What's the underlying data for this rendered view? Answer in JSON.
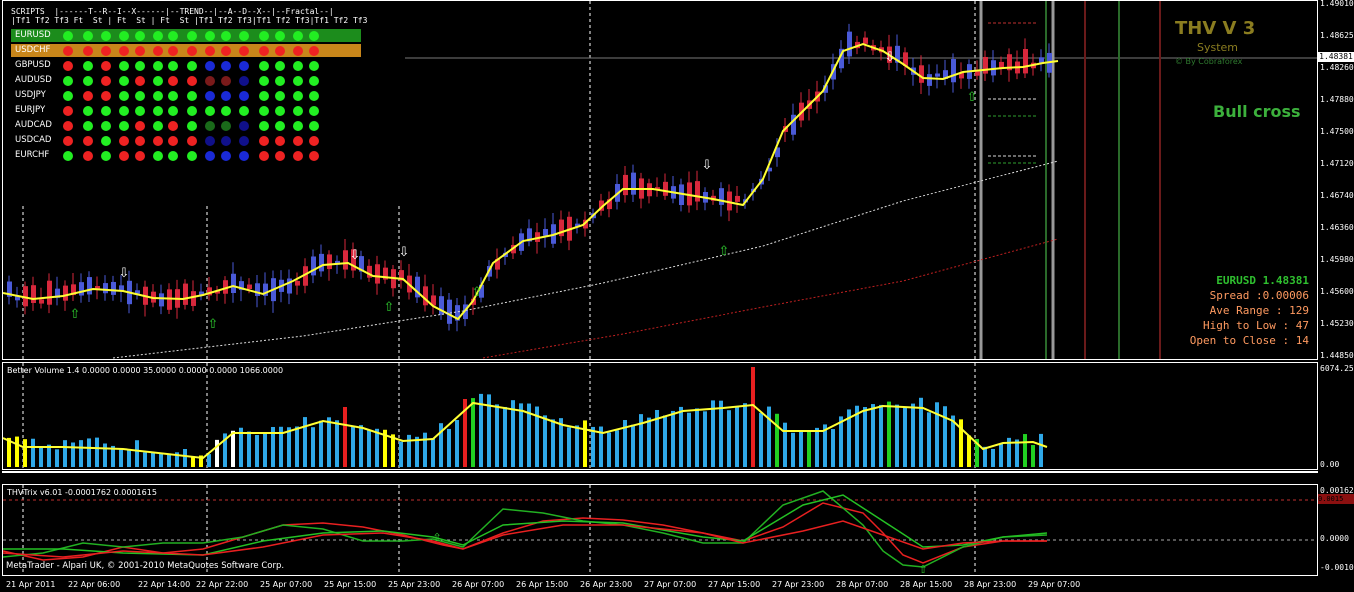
{
  "chart": {
    "symbol": "EURUSD",
    "current_price": "1.48381",
    "copyright": "MetaTrader - Alpari UK, © 2001-2010 MetaQuotes Software Corp."
  },
  "price_scale": [
    "1.49010",
    "1.48625",
    "1.48260",
    "1.47880",
    "1.47500",
    "1.47120",
    "1.46740",
    "1.46360",
    "1.45980",
    "1.45600",
    "1.45230",
    "1.44850"
  ],
  "volume_scale": [
    "6074.25",
    "0.00"
  ],
  "trix_scale": [
    "0.00162",
    "0.0000",
    "-0.00108"
  ],
  "trix_tag": "0.0015",
  "time_axis": [
    "21 Apr 2011",
    "22 Apr 06:00",
    "22 Apr 14:00",
    "22 Apr 22:00",
    "25 Apr 07:00",
    "25 Apr 15:00",
    "25 Apr 23:00",
    "26 Apr 07:00",
    "26 Apr 15:00",
    "26 Apr 23:00",
    "27 Apr 07:00",
    "27 Apr 15:00",
    "27 Apr 23:00",
    "28 Apr 07:00",
    "28 Apr 15:00",
    "28 Apr 23:00",
    "29 Apr 07:00"
  ],
  "scripts_panel": {
    "header_line1": "SCRIPTS  |------T--R--I--X------|--TREND--|--A--D--X--|--Fractal--|",
    "header_line2": "|Tf1 Tf2 Tf3 Ft  St | Ft  St | Ft  St |Tf1 Tf2 Tf3|Tf1 Tf2 Tf3|Tf1 Tf2 Tf3",
    "rows": [
      {
        "symbol": "EURUSD",
        "bg": "#1c8c1c"
      },
      {
        "symbol": "USDCHF",
        "bg": "#c8861a"
      },
      {
        "symbol": "GBPUSD",
        "bg": ""
      },
      {
        "symbol": "AUDUSD",
        "bg": ""
      },
      {
        "symbol": "USDJPY",
        "bg": ""
      },
      {
        "symbol": "EURJPY",
        "bg": ""
      },
      {
        "symbol": "AUDCAD",
        "bg": ""
      },
      {
        "symbol": "USDCAD",
        "bg": ""
      },
      {
        "symbol": "EURCHF",
        "bg": ""
      }
    ]
  },
  "thv": {
    "title": "THV V 3",
    "subtitle": "System",
    "byline": "© By Cobraforex",
    "signal": "Bull cross"
  },
  "info_box": {
    "symbol_price": "EURUSD  1.48381",
    "spread": "Spread :0.00006",
    "ave_range": "Ave Range :     129",
    "high_low": "High to Low :      47",
    "open_close": "Open to Close :      14"
  },
  "volume_title": "Better Volume 1.4 0.0000 0.0000 35.0000 0.0000 0.0000 1066.0000",
  "trix_title": "THVTrix v6.01 -0.0001762 0.0001615",
  "colors": {
    "bull_candle": "#4a5ad8",
    "bear_candle": "#d8283c",
    "ma_yellow": "#ffff33",
    "vol_blue": "#2fa8e8",
    "vol_red": "#e82020",
    "vol_green": "#22d022",
    "vol_white": "#ffffff",
    "vol_yellow": "#ffff00",
    "trix_red": "#e82020",
    "trix_green": "#22b022"
  }
}
